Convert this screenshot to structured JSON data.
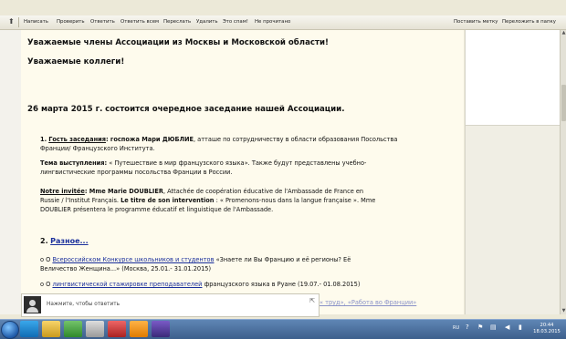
{
  "toolbar": {
    "items": [
      "Написать",
      "Проверить",
      "Ответить",
      "Ответить всем",
      "Переслать",
      "Удалить",
      "Это спам!",
      "Не прочитано"
    ],
    "right_items": [
      "Поставить метку",
      "Переложить в папку"
    ]
  },
  "message": {
    "greet1": "Уважаемые члены Ассоциации из Москвы и Московской области!",
    "greet2": "Уважаемые коллеги!",
    "date": "26 марта 2015 г.",
    "date_rest": "состоится очередное заседание нашей Ассоциации.",
    "guest": {
      "num": "1.",
      "label": "Гость  заседания",
      "name": ": госпожа Мари ДЮБЛИЕ",
      "text1": ", атташе по сотрудничеству в области образования Посольства",
      "text2": "Франции/ Французского Института."
    },
    "talk": {
      "label": "Тема выступления:",
      "text1": "« Путешествие в мир французского языка». Также будут представлены учебно-",
      "text2": "лингвистические программы посольства Франции в России."
    },
    "fr": {
      "label": "Notre invitée",
      "name": ": Mme Marie DOUBLIER",
      "text1": ", Attachée de coopération éducative de l'Ambassade de France en",
      "text2a": "Russie / l'Institut Français. ",
      "text2b": "Le titre de son intervention",
      "text2c": " : « Promenons-nous dans la langue française ». Mme",
      "text3": "DOUBLIER présentera le programme éducatif et linguistique de l'Ambassade."
    },
    "misc": {
      "num": "2.",
      "label": "Разное..."
    },
    "item1": {
      "bullet": "о О",
      "link": "Всероссийском Конкурсе школьников и студентов",
      "text": "«Знаете ли Вы Францию и её регионы? Её",
      "text2": "Величество Женщина...» (Москва, 25.01.- 31.01.2015)"
    },
    "item2": {
      "bullet": "о О",
      "link": "лингвистической стажировке преподавателей",
      "text": "французского языка в Руане (19.07.- 01.08.2015)"
    },
    "item3_partial": "« труд», «Работа во Франции»"
  },
  "reply": {
    "placeholder": "Нажмите, чтобы ответить"
  },
  "taskbar": {
    "lang": "RU",
    "time": "20:44",
    "date": "18.03.2015"
  },
  "colors": {
    "message_bg": "#fefbed",
    "link": "#1a2f9c",
    "taskbar": "#3b5d8a"
  }
}
